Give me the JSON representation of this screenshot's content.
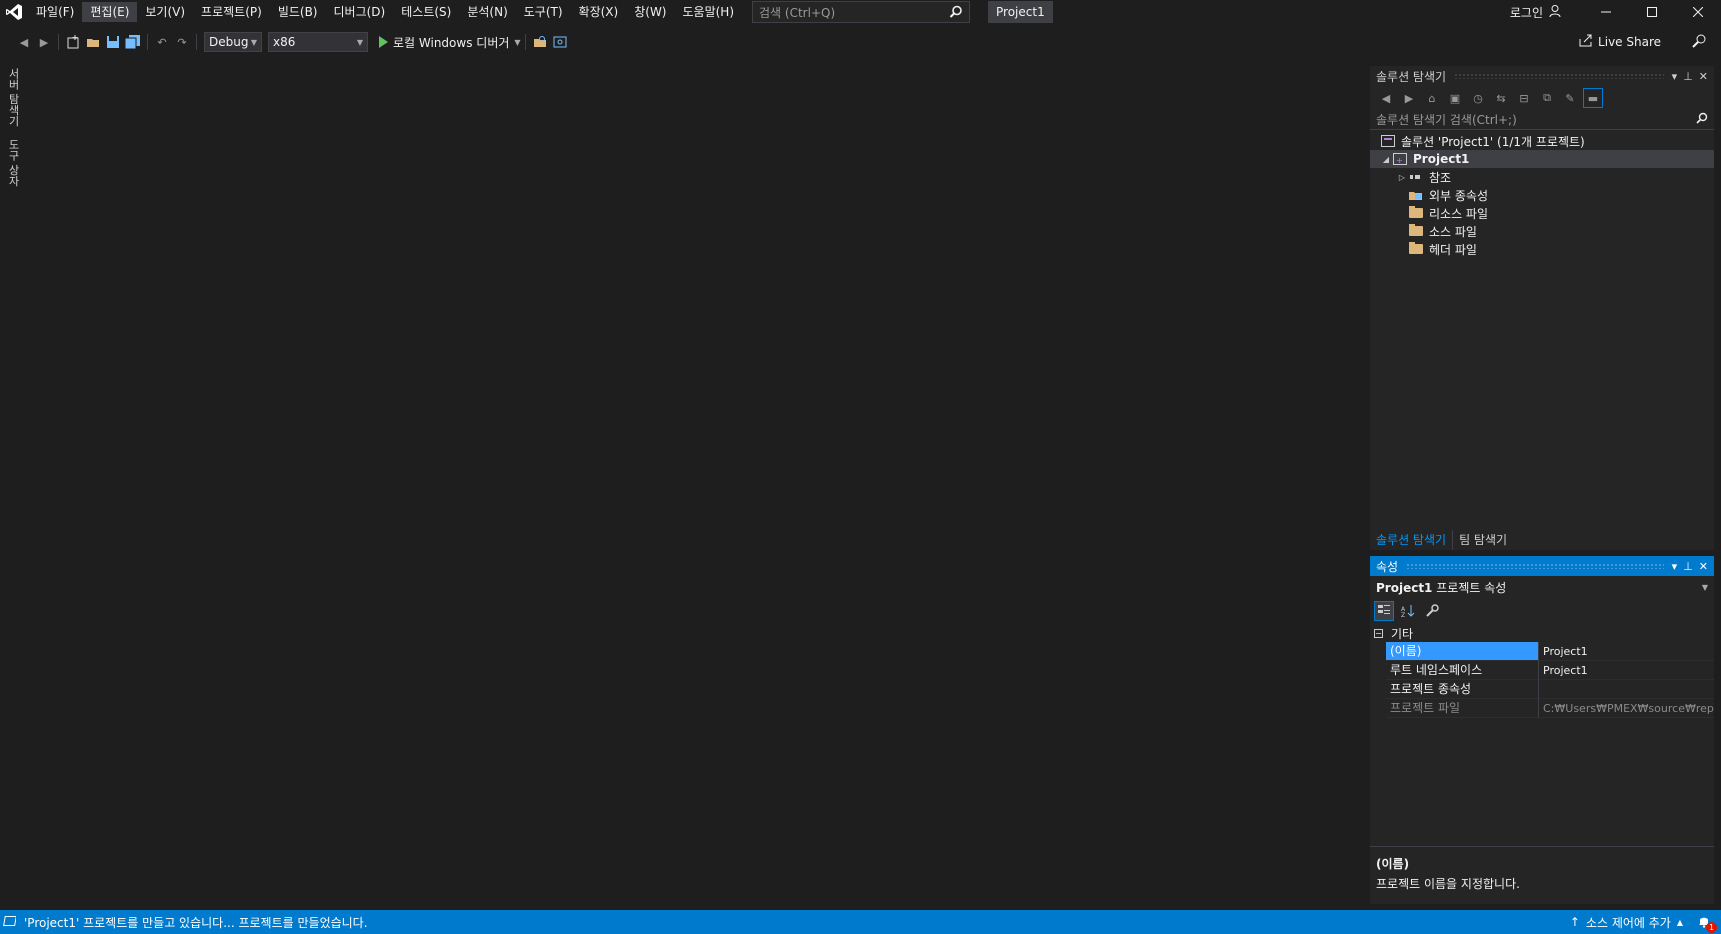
{
  "menu": [
    "파일(F)",
    "편집(E)",
    "보기(V)",
    "프로젝트(P)",
    "빌드(B)",
    "디버그(D)",
    "테스트(S)",
    "분석(N)",
    "도구(T)",
    "확장(X)",
    "창(W)",
    "도움말(H)"
  ],
  "search": {
    "placeholder": "검색 (Ctrl+Q)"
  },
  "title": {
    "project": "Project1",
    "login": "로그인"
  },
  "toolbar": {
    "config": "Debug",
    "platform": "x86",
    "run_label": "로컬 Windows 디버거",
    "live_share": "Live Share"
  },
  "left_tabs": [
    "서버 탐색기",
    "도구 상자"
  ],
  "solution_explorer": {
    "title": "솔루션 탐색기",
    "search_placeholder": "솔루션 탐색기 검색(Ctrl+;)",
    "solution": "솔루션 'Project1' (1/1개 프로젝트)",
    "project": "Project1",
    "items": [
      {
        "label": "참조",
        "icon": "references-icon",
        "expander": "▷"
      },
      {
        "label": "외부 종속성",
        "icon": "external-dependencies-icon",
        "expander": ""
      },
      {
        "label": "리소스 파일",
        "icon": "folder-icon",
        "expander": ""
      },
      {
        "label": "소스 파일",
        "icon": "folder-icon",
        "expander": ""
      },
      {
        "label": "헤더 파일",
        "icon": "folder-icon",
        "expander": ""
      }
    ],
    "tabs": [
      "솔루션 탐색기",
      "팀 탐색기"
    ]
  },
  "properties": {
    "title": "속성",
    "object_name": "Project1",
    "object_type": "프로젝트 속성",
    "category": "기타",
    "rows": [
      {
        "name": "(이름)",
        "value": "Project1"
      },
      {
        "name": "루트 네임스페이스",
        "value": "Project1"
      },
      {
        "name": "프로젝트 종속성",
        "value": ""
      },
      {
        "name": "프로젝트 파일",
        "value": "C:₩Users₩PMEX₩source₩repos₩"
      }
    ],
    "desc_title": "(이름)",
    "desc_text": "프로젝트 이름을 지정합니다."
  },
  "status": {
    "message": "'Project1' 프로젝트를 만들고 있습니다... 프로젝트를 만들었습니다.",
    "source_control": "소스 제어에 추가",
    "notifications": "1"
  },
  "colors": {
    "accent": "#007acc",
    "background": "#1e1e1e",
    "panel": "#252526",
    "run": "#63c160"
  }
}
